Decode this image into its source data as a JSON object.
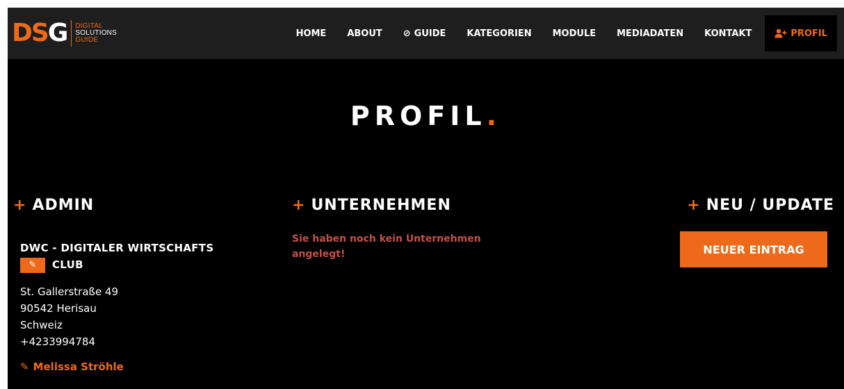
{
  "logo": {
    "mark_d": "D",
    "mark_s": "S",
    "mark_g": "G",
    "line1": "DIGITAL",
    "line2": "SOLUTIONS",
    "line3": "GUIDE"
  },
  "nav": {
    "items": [
      {
        "label": "HOME"
      },
      {
        "label": "ABOUT"
      },
      {
        "label": "GUIDE",
        "icon": "compass-icon"
      },
      {
        "label": "KATEGORIEN"
      },
      {
        "label": "MODULE"
      },
      {
        "label": "MEDIADATEN"
      },
      {
        "label": "KONTAKT"
      },
      {
        "label": "PROFIL",
        "icon": "user-plus-icon",
        "active": true
      }
    ]
  },
  "page": {
    "title": "PROFIL",
    "title_dot": "."
  },
  "admin": {
    "heading": "ADMIN",
    "company_line1": "DWC - DIGITALER WIRTSCHAFTS",
    "company_line2": "CLUB",
    "address": [
      "St. Gallerstraße 49",
      "90542 Herisau",
      "Schweiz",
      "+4233994784"
    ],
    "contact_name": "Melissa Ströhle"
  },
  "unternehmen": {
    "heading": "UNTERNEHMEN",
    "empty_message": "Sie haben noch kein Unternehmen angelegt!"
  },
  "neu": {
    "heading": "NEU / UPDATE",
    "button_label": "NEUER EINTRAG"
  },
  "colors": {
    "accent": "#ee6a1a",
    "background": "#000000",
    "header": "#1e1e1e",
    "warning_text": "#c2514a"
  }
}
